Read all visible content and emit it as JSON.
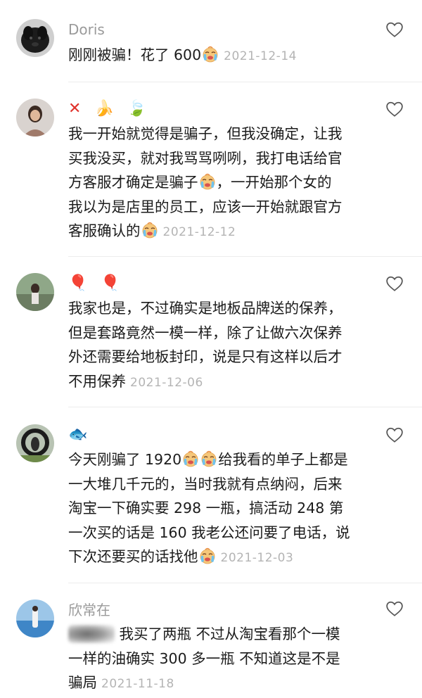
{
  "comments": [
    {
      "name": "Doris",
      "text_lines": [
        "刚刚被骗！花了 600"
      ],
      "date": "2021-12-14"
    },
    {
      "name_emojis": "❌🍌🍃",
      "text_lines": [
        "我一开始就觉得是骗子，但我没确定，让我",
        "买我没买，就对我骂骂咧咧，我打电话给官",
        "方客服才确定是骗子",
        "，一开始那个女的",
        "我以为是店里的员工，应该一开始就跟官方",
        "客服确认的"
      ],
      "date": "2021-12-12"
    },
    {
      "name_emojis": "🎈🎈",
      "text_lines": [
        "我家也是，不过确实是地板品牌送的保养，",
        "但是套路竟然一模一样，除了让做六次保养",
        "外还需要给地板封印，说是只有这样以后才",
        "不用保养"
      ],
      "date": "2021-12-06"
    },
    {
      "name_emojis": "🐟",
      "text_lines": [
        "今天刚骗了 1920",
        "给我看的单子上都是",
        "一大堆几千元的，当时我就有点纳闷，后来",
        "淘宝一下确实要 298 一瓶，搞活动 248 第",
        "一次买的话是 160 我老公还问要了电话，说",
        "下次还要买的话找他"
      ],
      "date": "2021-12-03"
    },
    {
      "name": "欣常在",
      "text_lines": [
        "我买了两瓶 不过从淘宝看那个一模",
        "一样的油确实 300 多一瓶  不知道这是不是",
        "骗局"
      ],
      "date": "2021-11-18"
    }
  ]
}
